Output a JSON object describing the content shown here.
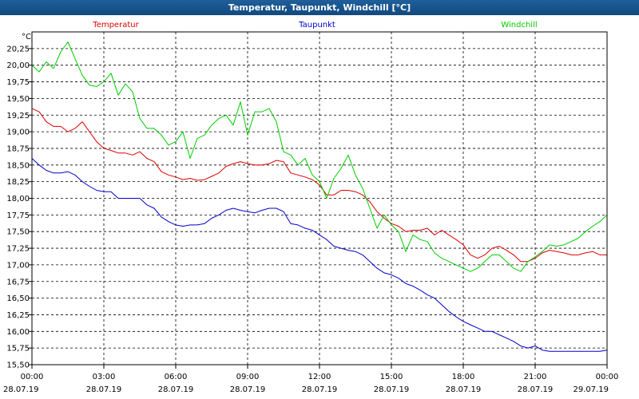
{
  "window": {
    "title": "Temperatur, Taupunkt, Windchill [°C]"
  },
  "chart_data": {
    "type": "line",
    "title": "Temperatur, Taupunkt, Windchill [°C]",
    "y_unit": "°C",
    "ylim": [
      15.5,
      20.5
    ],
    "y_ticks": [
      "15,50",
      "15,75",
      "16,00",
      "16,25",
      "16,50",
      "16,75",
      "17,00",
      "17,25",
      "17,50",
      "17,75",
      "18,00",
      "18,25",
      "18,50",
      "18,75",
      "19,00",
      "19,25",
      "19,50",
      "19,75",
      "20,00",
      "20,25"
    ],
    "x_range_hours": [
      0,
      24
    ],
    "x_ticks": [
      {
        "time": "00:00",
        "date": "28.07.19"
      },
      {
        "time": "03:00",
        "date": "28.07.19"
      },
      {
        "time": "06:00",
        "date": "28.07.19"
      },
      {
        "time": "09:00",
        "date": "28.07.19"
      },
      {
        "time": "12:00",
        "date": "28.07.19"
      },
      {
        "time": "15:00",
        "date": "28.07.19"
      },
      {
        "time": "18:00",
        "date": "28.07.19"
      },
      {
        "time": "21:00",
        "date": "28.07.19"
      },
      {
        "time": "00:00",
        "date": "29.07.19"
      }
    ],
    "grid": true,
    "legend_position": "top",
    "series": [
      {
        "name": "Temperatur",
        "color": "#dd0000",
        "points": [
          [
            0,
            19.35
          ],
          [
            0.3,
            19.3
          ],
          [
            0.6,
            19.15
          ],
          [
            0.9,
            19.08
          ],
          [
            1.2,
            19.08
          ],
          [
            1.5,
            19.0
          ],
          [
            1.8,
            19.05
          ],
          [
            2.1,
            19.15
          ],
          [
            2.4,
            19.0
          ],
          [
            2.7,
            18.85
          ],
          [
            3.0,
            18.75
          ],
          [
            3.3,
            18.72
          ],
          [
            3.6,
            18.68
          ],
          [
            3.9,
            18.68
          ],
          [
            4.2,
            18.65
          ],
          [
            4.5,
            18.7
          ],
          [
            4.8,
            18.6
          ],
          [
            5.1,
            18.55
          ],
          [
            5.4,
            18.4
          ],
          [
            5.7,
            18.35
          ],
          [
            6.0,
            18.32
          ],
          [
            6.3,
            18.28
          ],
          [
            6.6,
            18.3
          ],
          [
            6.9,
            18.27
          ],
          [
            7.2,
            18.28
          ],
          [
            7.5,
            18.33
          ],
          [
            7.8,
            18.38
          ],
          [
            8.1,
            18.48
          ],
          [
            8.4,
            18.52
          ],
          [
            8.7,
            18.55
          ],
          [
            9.0,
            18.52
          ],
          [
            9.3,
            18.5
          ],
          [
            9.6,
            18.5
          ],
          [
            9.9,
            18.52
          ],
          [
            10.2,
            18.57
          ],
          [
            10.5,
            18.55
          ],
          [
            10.8,
            18.38
          ],
          [
            11.1,
            18.35
          ],
          [
            11.4,
            18.32
          ],
          [
            11.7,
            18.28
          ],
          [
            12.0,
            18.2
          ],
          [
            12.3,
            18.05
          ],
          [
            12.6,
            18.05
          ],
          [
            12.9,
            18.12
          ],
          [
            13.2,
            18.12
          ],
          [
            13.5,
            18.1
          ],
          [
            13.8,
            18.05
          ],
          [
            14.1,
            17.95
          ],
          [
            14.4,
            17.8
          ],
          [
            14.7,
            17.7
          ],
          [
            15.0,
            17.62
          ],
          [
            15.3,
            17.58
          ],
          [
            15.6,
            17.5
          ],
          [
            15.9,
            17.52
          ],
          [
            16.2,
            17.52
          ],
          [
            16.5,
            17.55
          ],
          [
            16.8,
            17.45
          ],
          [
            17.1,
            17.52
          ],
          [
            17.4,
            17.45
          ],
          [
            17.7,
            17.38
          ],
          [
            18.0,
            17.3
          ],
          [
            18.3,
            17.15
          ],
          [
            18.6,
            17.1
          ],
          [
            18.9,
            17.15
          ],
          [
            19.2,
            17.25
          ],
          [
            19.5,
            17.28
          ],
          [
            19.8,
            17.22
          ],
          [
            20.1,
            17.15
          ],
          [
            20.4,
            17.05
          ],
          [
            20.7,
            17.05
          ],
          [
            21.0,
            17.1
          ],
          [
            21.3,
            17.18
          ],
          [
            21.6,
            17.22
          ],
          [
            21.9,
            17.2
          ],
          [
            22.2,
            17.18
          ],
          [
            22.5,
            17.15
          ],
          [
            22.8,
            17.15
          ],
          [
            23.1,
            17.18
          ],
          [
            23.4,
            17.2
          ],
          [
            23.7,
            17.15
          ],
          [
            24.0,
            17.15
          ]
        ]
      },
      {
        "name": "Taupunkt",
        "color": "#0000cc",
        "points": [
          [
            0,
            18.6
          ],
          [
            0.3,
            18.5
          ],
          [
            0.6,
            18.42
          ],
          [
            0.9,
            18.38
          ],
          [
            1.2,
            18.38
          ],
          [
            1.5,
            18.4
          ],
          [
            1.8,
            18.35
          ],
          [
            2.1,
            18.25
          ],
          [
            2.4,
            18.18
          ],
          [
            2.7,
            18.12
          ],
          [
            3.0,
            18.1
          ],
          [
            3.3,
            18.1
          ],
          [
            3.6,
            18.0
          ],
          [
            3.9,
            18.0
          ],
          [
            4.2,
            18.0
          ],
          [
            4.5,
            18.0
          ],
          [
            4.8,
            17.9
          ],
          [
            5.1,
            17.85
          ],
          [
            5.4,
            17.72
          ],
          [
            5.7,
            17.65
          ],
          [
            6.0,
            17.6
          ],
          [
            6.3,
            17.58
          ],
          [
            6.6,
            17.6
          ],
          [
            6.9,
            17.6
          ],
          [
            7.2,
            17.62
          ],
          [
            7.5,
            17.7
          ],
          [
            7.8,
            17.75
          ],
          [
            8.1,
            17.82
          ],
          [
            8.4,
            17.85
          ],
          [
            8.7,
            17.82
          ],
          [
            9.0,
            17.8
          ],
          [
            9.3,
            17.78
          ],
          [
            9.6,
            17.82
          ],
          [
            9.9,
            17.85
          ],
          [
            10.2,
            17.85
          ],
          [
            10.5,
            17.8
          ],
          [
            10.8,
            17.62
          ],
          [
            11.1,
            17.6
          ],
          [
            11.4,
            17.55
          ],
          [
            11.7,
            17.52
          ],
          [
            12.0,
            17.45
          ],
          [
            12.3,
            17.38
          ],
          [
            12.6,
            17.28
          ],
          [
            12.9,
            17.25
          ],
          [
            13.2,
            17.22
          ],
          [
            13.5,
            17.2
          ],
          [
            13.8,
            17.15
          ],
          [
            14.1,
            17.05
          ],
          [
            14.4,
            16.95
          ],
          [
            14.7,
            16.88
          ],
          [
            15.0,
            16.85
          ],
          [
            15.3,
            16.8
          ],
          [
            15.6,
            16.72
          ],
          [
            15.9,
            16.68
          ],
          [
            16.2,
            16.62
          ],
          [
            16.5,
            16.55
          ],
          [
            16.8,
            16.5
          ],
          [
            17.1,
            16.4
          ],
          [
            17.4,
            16.3
          ],
          [
            17.7,
            16.22
          ],
          [
            18.0,
            16.15
          ],
          [
            18.3,
            16.1
          ],
          [
            18.6,
            16.05
          ],
          [
            18.9,
            16.0
          ],
          [
            19.2,
            16.0
          ],
          [
            19.5,
            15.95
          ],
          [
            19.8,
            15.9
          ],
          [
            20.1,
            15.85
          ],
          [
            20.4,
            15.78
          ],
          [
            20.7,
            15.75
          ],
          [
            21.0,
            15.78
          ],
          [
            21.3,
            15.72
          ],
          [
            21.6,
            15.7
          ],
          [
            21.9,
            15.7
          ],
          [
            22.5,
            15.7
          ],
          [
            23.1,
            15.7
          ],
          [
            23.7,
            15.7
          ],
          [
            24.0,
            15.72
          ]
        ]
      },
      {
        "name": "Windchill",
        "color": "#00cc00",
        "points": [
          [
            0,
            20.0
          ],
          [
            0.3,
            19.9
          ],
          [
            0.6,
            20.05
          ],
          [
            0.9,
            19.95
          ],
          [
            1.2,
            20.2
          ],
          [
            1.5,
            20.35
          ],
          [
            1.8,
            20.1
          ],
          [
            2.1,
            19.85
          ],
          [
            2.4,
            19.7
          ],
          [
            2.7,
            19.68
          ],
          [
            3.0,
            19.75
          ],
          [
            3.3,
            19.88
          ],
          [
            3.6,
            19.55
          ],
          [
            3.9,
            19.72
          ],
          [
            4.2,
            19.6
          ],
          [
            4.5,
            19.2
          ],
          [
            4.8,
            19.05
          ],
          [
            5.1,
            19.05
          ],
          [
            5.4,
            18.95
          ],
          [
            5.7,
            18.8
          ],
          [
            6.0,
            18.85
          ],
          [
            6.3,
            19.0
          ],
          [
            6.6,
            18.6
          ],
          [
            6.9,
            18.9
          ],
          [
            7.2,
            18.95
          ],
          [
            7.5,
            19.1
          ],
          [
            7.8,
            19.2
          ],
          [
            8.1,
            19.25
          ],
          [
            8.4,
            19.1
          ],
          [
            8.7,
            19.45
          ],
          [
            9.0,
            18.95
          ],
          [
            9.3,
            19.3
          ],
          [
            9.6,
            19.3
          ],
          [
            9.9,
            19.35
          ],
          [
            10.2,
            19.15
          ],
          [
            10.5,
            18.7
          ],
          [
            10.8,
            18.65
          ],
          [
            11.1,
            18.5
          ],
          [
            11.4,
            18.6
          ],
          [
            11.7,
            18.35
          ],
          [
            12.0,
            18.25
          ],
          [
            12.3,
            18.0
          ],
          [
            12.6,
            18.3
          ],
          [
            12.9,
            18.45
          ],
          [
            13.2,
            18.65
          ],
          [
            13.5,
            18.35
          ],
          [
            13.8,
            18.15
          ],
          [
            14.1,
            17.85
          ],
          [
            14.4,
            17.55
          ],
          [
            14.7,
            17.75
          ],
          [
            15.0,
            17.6
          ],
          [
            15.3,
            17.5
          ],
          [
            15.6,
            17.2
          ],
          [
            15.9,
            17.45
          ],
          [
            16.2,
            17.38
          ],
          [
            16.5,
            17.35
          ],
          [
            16.8,
            17.18
          ],
          [
            17.1,
            17.1
          ],
          [
            17.4,
            17.05
          ],
          [
            17.7,
            17.0
          ],
          [
            18.0,
            16.95
          ],
          [
            18.3,
            16.9
          ],
          [
            18.6,
            16.95
          ],
          [
            18.9,
            17.05
          ],
          [
            19.2,
            17.15
          ],
          [
            19.5,
            17.15
          ],
          [
            19.8,
            17.05
          ],
          [
            20.1,
            16.95
          ],
          [
            20.4,
            16.9
          ],
          [
            20.7,
            17.05
          ],
          [
            21.0,
            17.12
          ],
          [
            21.3,
            17.2
          ],
          [
            21.6,
            17.3
          ],
          [
            21.9,
            17.28
          ],
          [
            22.2,
            17.3
          ],
          [
            22.5,
            17.35
          ],
          [
            22.8,
            17.4
          ],
          [
            23.1,
            17.5
          ],
          [
            23.4,
            17.58
          ],
          [
            23.7,
            17.65
          ],
          [
            24.0,
            17.75
          ]
        ]
      }
    ]
  }
}
